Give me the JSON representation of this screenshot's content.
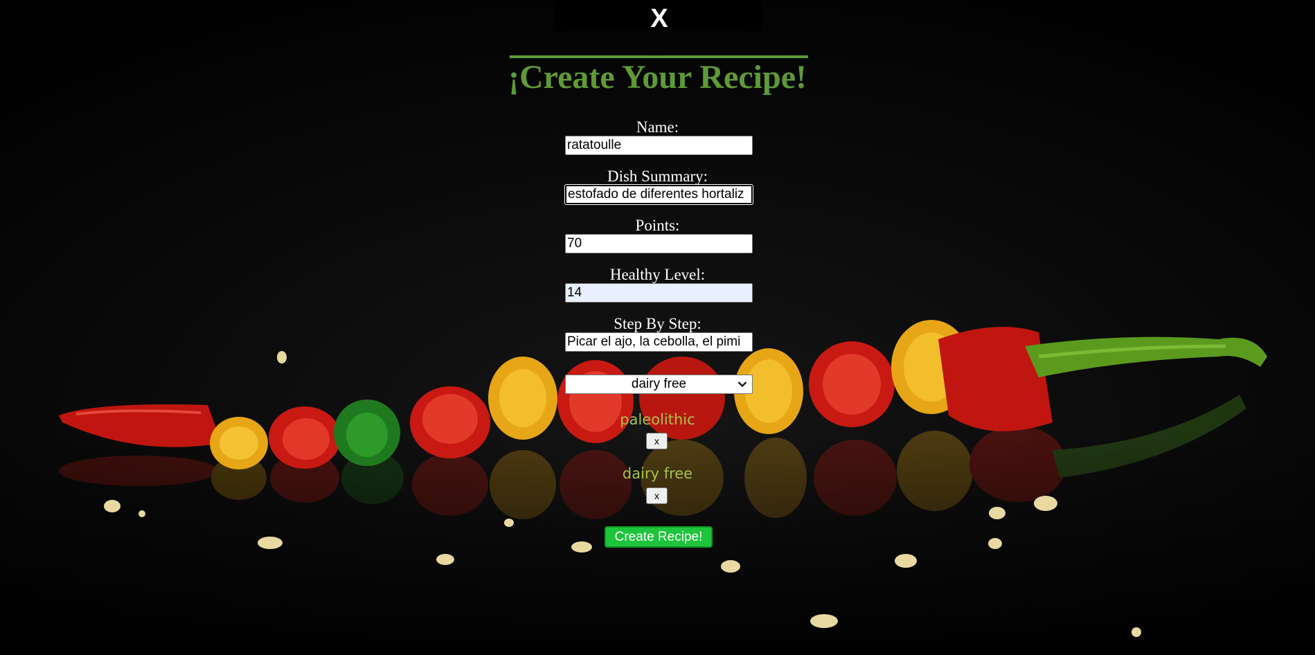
{
  "modal": {
    "close_label": "X"
  },
  "form": {
    "title": "¡Create Your Recipe!",
    "fields": [
      {
        "label": "Name:",
        "value": "ratatoulle"
      },
      {
        "label": "Dish Summary:",
        "value": "estofado de diferentes hortaliz"
      },
      {
        "label": "Points:",
        "value": "70"
      },
      {
        "label": "Healthy Level:",
        "value": "14"
      },
      {
        "label": "Step By Step:",
        "value": "Picar el ajo, la cebolla, el pimi"
      }
    ],
    "diet_select": {
      "selected": "dairy free"
    },
    "tags": [
      {
        "name": "paleolithic",
        "remove_label": "x"
      },
      {
        "name": "dairy free",
        "remove_label": "x"
      }
    ],
    "submit_label": "Create Recipe!"
  },
  "colors": {
    "title": "#5e9a37",
    "tag_text": "#a8c34b",
    "submit_button": "#1ec43c",
    "background": "#050505"
  }
}
